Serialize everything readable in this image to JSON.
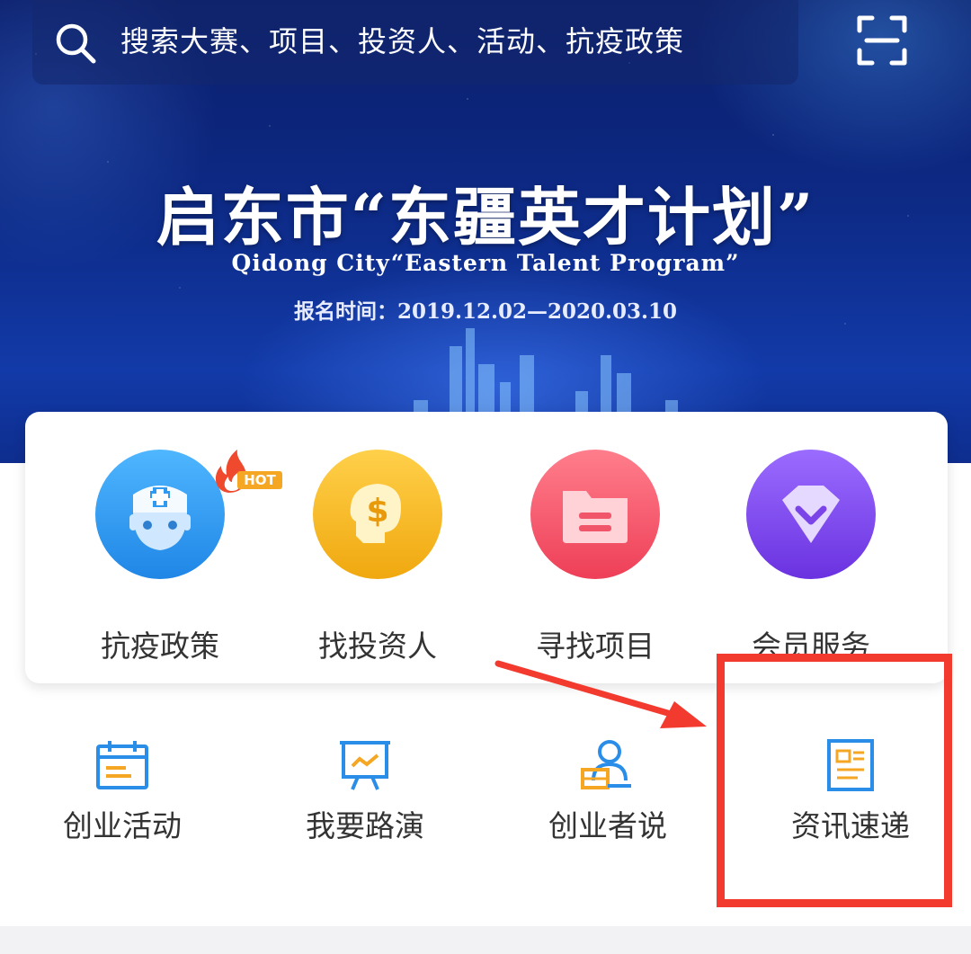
{
  "search": {
    "placeholder": "搜索大赛、项目、投资人、活动、抗疫政策"
  },
  "banner": {
    "title": "启东市“东疆英才计划”",
    "subtitle": "Qidong City“Eastern Talent Program”",
    "date": "报名时间：2019.12.02—2020.03.10"
  },
  "main_menu": [
    {
      "label": "抗疫政策",
      "icon": "doctor-mask-icon",
      "color": "#2f9af0",
      "badge": "HOT"
    },
    {
      "label": "找投资人",
      "icon": "investor-dollar-icon",
      "color": "#f2b21c"
    },
    {
      "label": "寻找项目",
      "icon": "folder-icon",
      "color": "#f2566a"
    },
    {
      "label": "会员服务",
      "icon": "diamond-icon",
      "color": "#7a44e8"
    }
  ],
  "sub_menu": [
    {
      "label": "创业活动",
      "icon": "calendar-icon"
    },
    {
      "label": "我要路演",
      "icon": "presentation-board-icon"
    },
    {
      "label": "创业者说",
      "icon": "speaker-person-icon"
    },
    {
      "label": "资讯速递",
      "icon": "news-icon"
    }
  ],
  "colors": {
    "icon_blue": "#2a8ee8",
    "icon_orange": "#f5a623",
    "annotation_red": "#f23a2e"
  }
}
